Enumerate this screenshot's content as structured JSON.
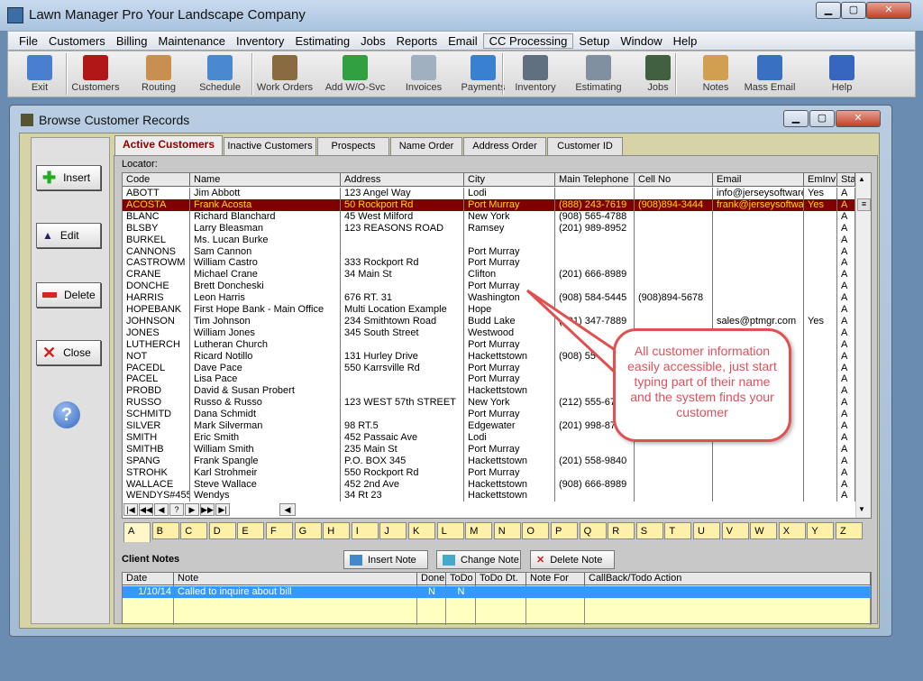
{
  "app": {
    "title": "Lawn Manager Pro  Your Landscape Company"
  },
  "menu": [
    "File",
    "Customers",
    "Billing",
    "Maintenance",
    "Inventory",
    "Estimating",
    "Jobs",
    "Reports",
    "Email",
    "CC Processing",
    "Setup",
    "Window",
    "Help"
  ],
  "toolbar": [
    {
      "label": "Exit",
      "icon": "exit-icon",
      "color": "#4a7fd0"
    },
    {
      "label": "Customers",
      "icon": "customers-icon",
      "color": "#b01818"
    },
    {
      "label": "Routing",
      "icon": "clipboard-icon",
      "color": "#c89050"
    },
    {
      "label": "Schedule",
      "icon": "calendar-icon",
      "color": "#4a88d0"
    },
    {
      "label": "Work Orders",
      "icon": "work-orders-icon",
      "color": "#8a6a40"
    },
    {
      "label": "Add W/O-Svc",
      "icon": "add-icon",
      "color": "#30a040"
    },
    {
      "label": "Invoices",
      "icon": "invoice-icon",
      "color": "#a0b0c0"
    },
    {
      "label": "Payments",
      "icon": "payment-icon",
      "color": "#3a80d0"
    },
    {
      "label": "Inventory",
      "icon": "inventory-icon",
      "color": "#607080"
    },
    {
      "label": "Estimating",
      "icon": "estimating-icon",
      "color": "#8090a0"
    },
    {
      "label": "Jobs",
      "icon": "jobs-icon",
      "color": "#406040"
    },
    {
      "label": "Notes",
      "icon": "notes-icon",
      "color": "#d0a050"
    },
    {
      "label": "Mass Email",
      "icon": "mass-email-icon",
      "color": "#3a70c0"
    },
    {
      "label": "Help",
      "icon": "help-icon",
      "color": "#3766c0"
    }
  ],
  "window": {
    "title": "Browse Customer Records"
  },
  "side": {
    "insert": "Insert",
    "edit": "Edit",
    "delete": "Delete",
    "close": "Close",
    "help": "?"
  },
  "tabs": [
    "Active Customers",
    "Inactive Customers",
    "Prospects",
    "Name Order",
    "Address Order",
    "Customer ID"
  ],
  "locator": "Locator:",
  "columns": [
    "Code",
    "Name",
    "Address",
    "City",
    "Main Telephone",
    "Cell No",
    "Email",
    "EmInv",
    "Sta"
  ],
  "rows": [
    [
      "ABOTT",
      "Jim Abbott",
      "123 Angel Way",
      "Lodi",
      "",
      "",
      "info@jerseysoftware.",
      "Yes",
      "A"
    ],
    [
      "ACOSTA",
      "Frank Acosta",
      "50 Rockport Rd",
      "Port Murray",
      "(888) 243-7619",
      "(908)894-3444",
      "frank@jerseysoftwar",
      "Yes",
      "A"
    ],
    [
      "BLANC",
      "Richard Blanchard",
      "45 West Milford",
      "New York",
      "(908) 565-4788",
      "",
      "",
      "",
      "A"
    ],
    [
      "BLSBY",
      "Larry Bleasman",
      "123 REASONS ROAD",
      "Ramsey",
      "(201) 989-8952",
      "",
      "",
      "",
      "A"
    ],
    [
      "BURKEL",
      "Ms. Lucan Burke",
      "",
      "",
      "",
      "",
      "",
      "",
      "A"
    ],
    [
      "CANNONS",
      "Sam Cannon",
      "",
      "Port Murray",
      "",
      "",
      "",
      "",
      "A"
    ],
    [
      "CASTROWM",
      "William Castro",
      "333 Rockport Rd",
      "Port Murray",
      "",
      "",
      "",
      "",
      "A"
    ],
    [
      "CRANE",
      "Michael Crane",
      "34 Main St",
      "Clifton",
      "(201) 666-8989",
      "",
      "",
      "",
      "A"
    ],
    [
      "DONCHE",
      "Brett Doncheski",
      "",
      "Port Murray",
      "",
      "",
      "",
      "",
      "A"
    ],
    [
      "HARRIS",
      "Leon Harris",
      "676 RT. 31",
      "Washington",
      "(908) 584-5445",
      "(908)894-5678",
      "",
      "",
      "A"
    ],
    [
      "HOPEBANK",
      "First Hope Bank - Main Office",
      "Multi Location Example",
      "Hope",
      "",
      "",
      "",
      "",
      "A"
    ],
    [
      "JOHNSON",
      "Tim Johnson",
      "234 Smithtown Road",
      "Budd Lake",
      "(201) 347-7889",
      "",
      "sales@ptmgr.com",
      "Yes",
      "A"
    ],
    [
      "JONES",
      "William Jones",
      "345 South Street",
      "Westwood",
      "",
      "",
      "",
      "",
      "A"
    ],
    [
      "LUTHERCH",
      "Lutheran Church",
      "",
      "Port Murray",
      "",
      "",
      "",
      "",
      "A"
    ],
    [
      "NOT",
      "Ricard Notillo",
      "131 Hurley Drive",
      "Hackettstown",
      "(908) 55",
      "",
      "",
      "",
      "A"
    ],
    [
      "PACEDL",
      "Dave Pace",
      "550 Karrsville Rd",
      "Port Murray",
      "",
      "",
      "",
      "",
      "A"
    ],
    [
      "PACEL",
      "Lisa Pace",
      "",
      "Port Murray",
      "",
      "",
      "",
      "",
      "A"
    ],
    [
      "PROBD",
      "David & Susan Probert",
      "",
      "Hackettstown",
      "",
      "",
      "",
      "",
      "A"
    ],
    [
      "RUSSO",
      "Russo & Russo",
      "123 WEST 57th STREET",
      "New York",
      "(212) 555-678",
      "",
      "",
      "",
      "A"
    ],
    [
      "SCHMITD",
      "Dana Schmidt",
      "",
      "Port Murray",
      "",
      "",
      "",
      "",
      "A"
    ],
    [
      "SILVER",
      "Mark Silverman",
      "98 RT.5",
      "Edgewater",
      "(201) 998-878",
      "",
      "",
      "",
      "A"
    ],
    [
      "SMITH",
      "Eric Smith",
      "452 Passaic Ave",
      "Lodi",
      "",
      "",
      "",
      "",
      "A"
    ],
    [
      "SMITHB",
      "William Smith",
      "235 Main St",
      "Port Murray",
      "",
      "",
      "",
      "",
      "A"
    ],
    [
      "SPANG",
      "Frank Spangle",
      "P.O. BOX 345",
      "Hackettstown",
      "(201) 558-9840",
      "",
      "",
      "",
      "A"
    ],
    [
      "STROHK",
      "Karl Strohmeir",
      "550 Rockport Rd",
      "Port Murray",
      "",
      "",
      "",
      "",
      "A"
    ],
    [
      "WALLACE",
      "Steve Wallace",
      "452 2nd Ave",
      "Hackettstown",
      "(908) 666-8989",
      "",
      "",
      "",
      "A"
    ],
    [
      "WENDYS#455",
      "Wendys",
      "34 Rt 23",
      "Hackettstown",
      "",
      "",
      "",
      "",
      "A"
    ]
  ],
  "selected_row": 1,
  "navigator": [
    "|◀",
    "◀◀",
    "◀",
    "?",
    "▶",
    "▶▶",
    "▶|"
  ],
  "letters": [
    "A",
    "B",
    "C",
    "D",
    "E",
    "F",
    "G",
    "H",
    "I",
    "J",
    "K",
    "L",
    "M",
    "N",
    "O",
    "P",
    "Q",
    "R",
    "S",
    "T",
    "U",
    "V",
    "W",
    "X",
    "Y",
    "Z"
  ],
  "notes": {
    "title": "Client Notes",
    "insert": "Insert Note",
    "change": "Change Note",
    "delete": "Delete Note",
    "columns": [
      "Date",
      "Note",
      "Done",
      "ToDo",
      "ToDo Dt.",
      "Note For",
      "CallBack/Todo Action"
    ],
    "rows": [
      [
        "1/10/14",
        "Called to inquire about bill",
        "N",
        "N",
        "",
        "",
        ""
      ]
    ]
  },
  "callout": "All customer information easily accessible, just start typing part of their name and the system finds your customer"
}
